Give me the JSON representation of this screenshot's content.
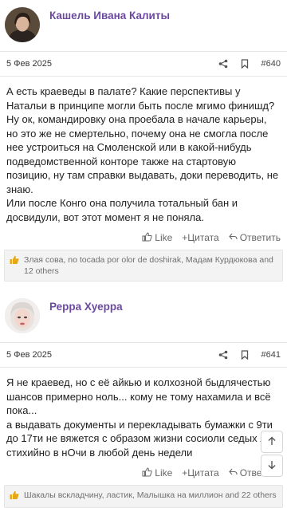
{
  "posts": [
    {
      "author": "Кашель Ивана Калиты",
      "date": "5 Фев 2025",
      "number": "#640",
      "paragraphs": [
        "А есть краеведы в палате? Какие перспективы у Натальи в принципе могли быть после мгимо финишд?",
        "Ну ок, командировку она проебала в начале карьеры, но это же не смертельно, почему она не смогла после нее устроиться на Смоленской или в какой-нибудь подведомственной конторе также на стартовую позицию, ну там справки выдавать, доки переводить, не знаю.",
        "Или после Конго она получила тотальный бан и досвидули, вот этот момент я не поняла."
      ],
      "actions": {
        "like": "Like",
        "quote": "+Цитата",
        "reply": "Ответить"
      },
      "likes_text": "Злая сова, no tocada por olor de doshirak, Мадам Курдюкова and 12 others"
    },
    {
      "author": "Рерра Хуерра",
      "date": "5 Фев 2025",
      "number": "#641",
      "paragraphs": [
        "Я не краевед, но с её айкью и колхозной быдлячестью шансов примерно ноль... кому не тому нахамила и всё пока...",
        "а выдавать документы и перекладывать бумажки с 9ти до 17ти не вяжется с образом жизни сосиоли седых яиц стихийно в нОчи в любой день недели"
      ],
      "actions": {
        "like": "Like",
        "quote": "+Цитата",
        "reply": "Ответить"
      },
      "likes_text": "Шакалы вскладчину, ластик, Малышка на миллион and 22 others"
    }
  ],
  "icons": {
    "share": "share-icon",
    "bookmark": "bookmark-icon",
    "like": "thumbs-up-icon",
    "scroll_up": "arrow-up-icon",
    "scroll_down": "arrow-down-icon"
  },
  "colors": {
    "author": "#6b4aa0",
    "like_thumb": "#e6a817"
  }
}
